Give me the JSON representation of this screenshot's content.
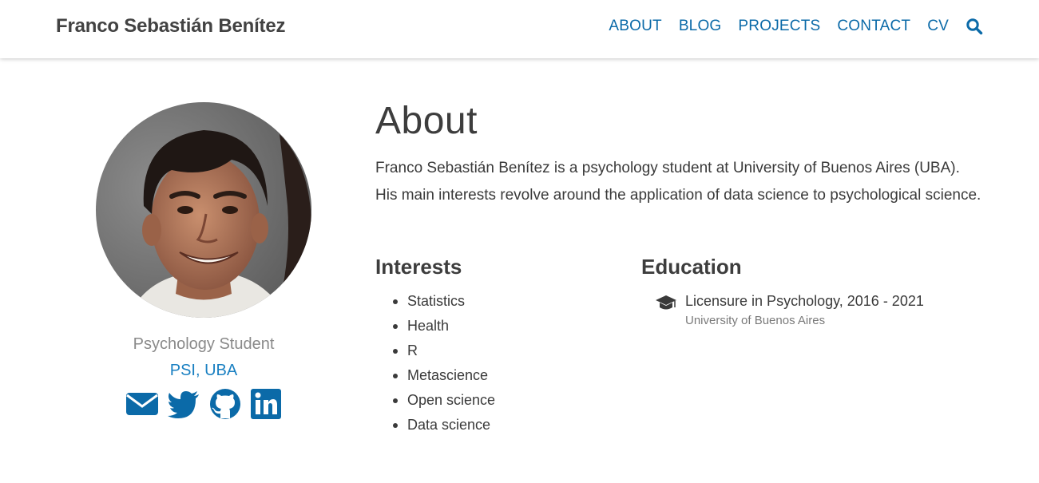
{
  "site": {
    "brand": "Franco Sebastián Benítez"
  },
  "nav": {
    "items": [
      {
        "label": "ABOUT"
      },
      {
        "label": "BLOG"
      },
      {
        "label": "PROJECTS"
      },
      {
        "label": "CONTACT"
      },
      {
        "label": "CV"
      }
    ],
    "search_icon": "search-icon"
  },
  "profile": {
    "role": "Psychology Student",
    "organization": "PSI, UBA",
    "social": [
      {
        "icon": "envelope-icon"
      },
      {
        "icon": "twitter-icon"
      },
      {
        "icon": "github-icon"
      },
      {
        "icon": "linkedin-icon"
      }
    ]
  },
  "about": {
    "title": "About",
    "bio": "Franco Sebastián Benítez is a psychology student at University of Buenos Aires (UBA). His main interests revolve around the application of data science to psychological science."
  },
  "interests": {
    "heading": "Interests",
    "items": [
      "Statistics",
      "Health",
      "R",
      "Metascience",
      "Open science",
      "Data science"
    ]
  },
  "education": {
    "heading": "Education",
    "items": [
      {
        "icon": "graduation-cap-icon",
        "degree": "Licensure in Psychology, 2016 - 2021",
        "institution": "University of Buenos Aires"
      }
    ]
  },
  "colors": {
    "accent": "#0b6aa8",
    "link": "#1a80c2",
    "text": "#3a3a3a",
    "muted": "#8a8a8a"
  }
}
